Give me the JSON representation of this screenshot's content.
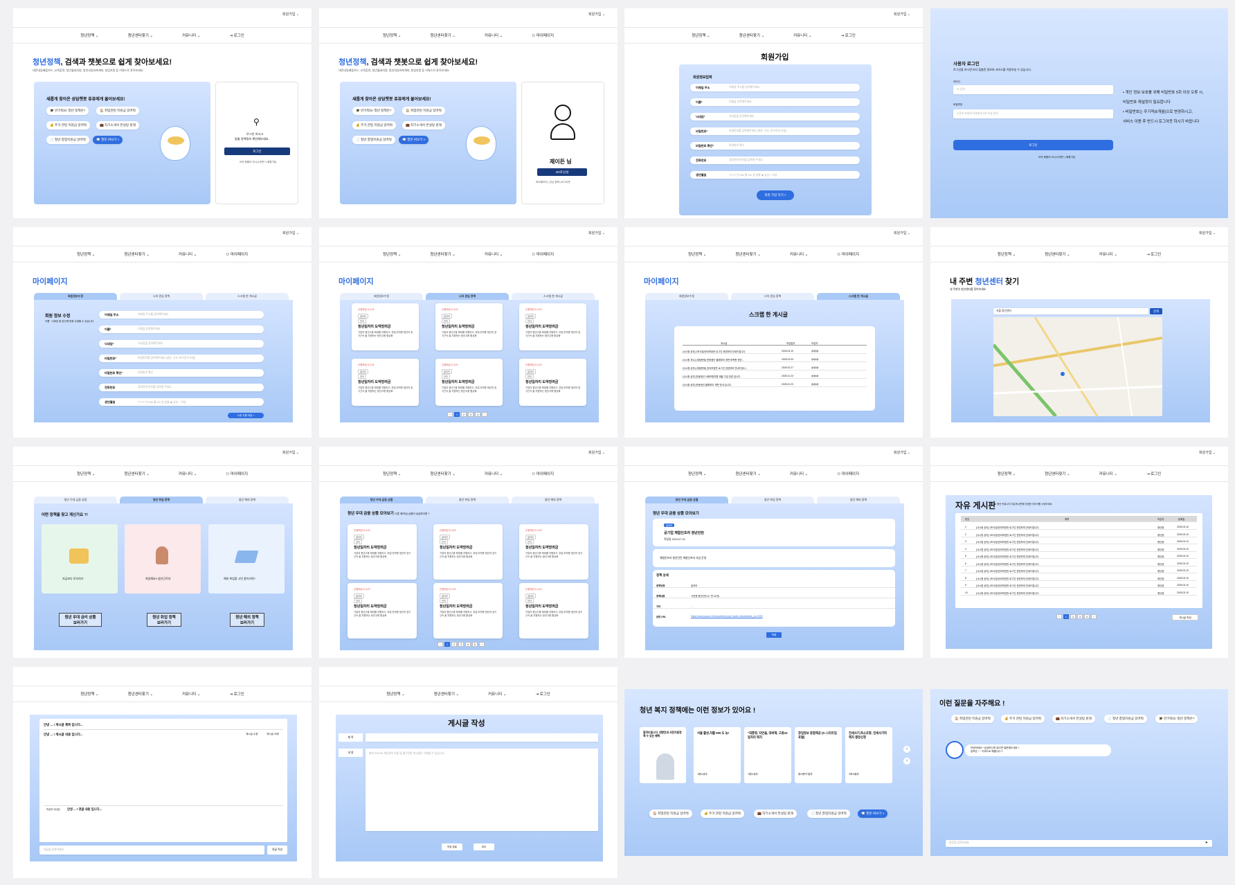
{
  "common": {
    "util": "회원가입 ⌄",
    "nav": [
      "청년정책 ⌄",
      "청년센터찾기 ⌄",
      "커뮤니티 ⌄"
    ],
    "login": "⇥ 로그인",
    "mypage": "⚇ 마이페이지"
  },
  "home": {
    "title_acc": "청년정책",
    "title_rest": ", 검색과 챗봇으로 쉽게 찾아보세요!",
    "sub": "대전내일배움카드, 교육훈련, 청년월세지원, 청년내일저축계좌, 창업지원 등 키워드로 찾아보세요.",
    "chat_title": "새롭게 찾아온 상담챗봇 퓨퓨에게 물어보세요!",
    "chips": [
      "🎓 반가워요! 청년 정책은?",
      "🏠 취업관련 지원금 알려줘",
      "💰 주거 관련 지원금 알려줘",
      "💼 자기소개서 컨설팅 원해",
      "📄 청년 창업지원금 알려줘",
      "💬 챗봇 써보기 >"
    ],
    "login_msg1": "로그인 하시고",
    "login_msg2": "맞춤 정책정보 확인해보세요.",
    "login_btn": "로그인",
    "login_links": "아직 회원이 아니시라면? | 회원가입",
    "user_name": "제이든 님",
    "user_btn": "25세 남성",
    "user_links": "마이페이지 | 관심 정책 | 로그아웃"
  },
  "signup": {
    "title": "회원가입",
    "section": "회원정보입력",
    "fields": [
      [
        "이메일 주소",
        "이메일 주소를 입력해주세요."
      ],
      [
        "이름*",
        "이름을 입력해주세요."
      ],
      [
        "닉네임*",
        "닉네임을 입력해주세요."
      ],
      [
        "비밀번호*",
        "비밀번호를 입력해주세요 (영문, 숫자, 특수문자 조합)"
      ],
      [
        "비밀번호 확인*",
        "비밀번호 확인"
      ],
      [
        "전화번호",
        "휴대전화 번호를 입력해 주세요"
      ],
      [
        "생년월일",
        "YYYY  년  MM  월  DD  일   성별  ◉ 남성  ○ 여성"
      ]
    ],
    "btn": "회원 가입 하기 >"
  },
  "login": {
    "title": "사용자 로그인",
    "sub": "로그인을 하시면 보다 맞춤된 정보와 서비스를 이용하실 수 있습니다.",
    "id_label": "아이디",
    "id_ph": "ID 입력",
    "pw_label": "비밀번호",
    "pw_ph": "소문자 포함된 비밀번호 8자 이상 입력",
    "btn": "로그인",
    "links": "아직 회원이 아니시라면? | 회원가입",
    "notes": [
      "• 개인 정보 보호를 위해 비밀번호 5회 이상 오류 시,",
      "  비밀번호 재설정이 필요합니다",
      "• 비밀번호는 주기적(6개월)으로 변경하시고,",
      "  서비스 이용 후 반드시 로그아웃 하시기 바랍니다"
    ]
  },
  "mypage": {
    "title": "마이페이지",
    "tabs": [
      "회원정보수정",
      "나의 관심 정책",
      "스크랩 한 게시글"
    ],
    "edit_title": "회원 정보 수정",
    "edit_sub": "이름 · 닉네임 등 당신에 맞춰 수정할 수 있습니다.",
    "edit_btn": "수정 사항 저장 >",
    "scrap_title": "스크랩 한 게시글",
    "scrap_head": [
      "게시글",
      "작성일자",
      "작성자"
    ],
    "scrap_rows": [
      [
        "[사시청 공지] 1조사업/권리보장반 로그인 관련하여 안내드립니다.",
        "2025.03.10",
        "@@@"
      ],
      [
        "[사시청 게시] (계정문제) 운동청년 올해부터 개편 토목총 관련 ...",
        "2025.03.03",
        "@@@"
      ],
      [
        "[사시청 공지] (계정문제) 권리보장반 로그인 관련하여 안내드립니...",
        "2025.02.27",
        "@@@"
      ],
      [
        "[사시청 공지] 운동청년 사회보험지원 제출 가입 관련 입니다",
        "2025.01.23",
        "@@@"
      ],
      [
        "[사시청 공지] 운동청년 올해부터 개편 안내 입니다",
        "2025.01.23",
        "@@@"
      ]
    ]
  },
  "card": {
    "tag": "신청마감 D-123",
    "t1": "일자리",
    "t2": "전국",
    "title": "청년일자리 도약장려금",
    "body": "기업의 청년고용 확대를 지원하고, 취업 취약층 청년의 장기근속 을 지원하는 청년고용 활성화"
  },
  "center": {
    "title_a": "내 주변 ",
    "title_acc": "청년센터",
    "title_b": " 찾기",
    "sub": "내 주변의 청년센터를 찾아보세요",
    "search": "서울 청년센터",
    "search_btn": "검색"
  },
  "policy": {
    "tabs": [
      "청년 우대 금융 상품",
      "청년 취업 정책",
      "청년 해외 정책"
    ],
    "question": "어떤 정책을 찾고 계신가요 ?!",
    "items": [
      "지금보다 투자하기",
      "취업해요!! 청년근로자",
      "해외 취업을 고민 중이라면?"
    ],
    "btns": [
      "청년 우대 금리 상품\n보러가기",
      "청년 취업 정책\n보러가기",
      "청년 해외 정책\n보러가기"
    ],
    "list_title": "청년 우대 금융 상품 모아보기",
    "list_sub": "다른 예/적금 상품이 궁금하다면 ?",
    "detail_badge": "일자리",
    "detail_title": "공기업 체험인프라 청년인턴",
    "detail_date": "작성일  2024.07.23",
    "detail_desc": "체험인프라 청년인턴 체험인프라 사업 운영",
    "detail_sec": "정책 상세",
    "detail_rows": [
      [
        "정책유형",
        "일자리"
      ],
      [
        "정책내용",
        "사전정 청년인턴 (1~연 24개)"
      ],
      [
        "기타",
        "-"
      ],
      [
        "관련 URL",
        "https://www.ycaa.or.kr/board/notice.jsp?mode=view&article_no=2025"
      ]
    ],
    "detail_btn": "목록"
  },
  "board": {
    "title": "자유 게시판",
    "sub": "청년 커뮤니티 자유게시판에 다양한 이야기를 나눠보세요",
    "head": [
      "번호",
      "제목",
      "작성자",
      "등록일"
    ],
    "row": "[사시청 공지] 1조사업/권리보장반 로그인 관련하여 안내드립니다.",
    "writer": "청년광",
    "date": "2025.03.10",
    "btn": "게시글 작성"
  },
  "post": {
    "title": "안녕 ... ! 게시글 제목 입니다...",
    "body": "안녕 ... ! 게시글 내용 입니다...",
    "edit": "게시글 수정",
    "del": "게시글 삭제",
    "c_author": "작성자 닉네임",
    "c_text": "안녕 ... ! 댓글 내용 입니다...",
    "c_ph": "댓글을 입력하세요.",
    "c_btn": "댓글 작성"
  },
  "write": {
    "title": "게시글 작성",
    "label_t": "제 목",
    "label_c": "내 용",
    "ph": "최대 3000자 개인정보 유출 및 불건전한 게시물은 삭제될 수 있습니다.",
    "save": "작성 완료",
    "cancel": "취소"
  },
  "welfare": {
    "title": "청년 복지 정책에는 이런 정보가 있어요 !",
    "intro": "알려드립니다. 대량안내 서민지원정책 수 있는 혜택",
    "cards": [
      "서울 활성,자활 500 도 농!",
      "\"대통령, 자연을, 대비해, 고용24 일자리 뭐지",
      "창업정보 종합제공 (K-스타트업 포털)",
      "전세사기,독소조항, 전세사기피해자 결정신청"
    ],
    "orgs": [
      "고용노동부",
      "고용노동부",
      "중소벤처기업부",
      "국토교통부"
    ],
    "chips": [
      "🏠 취업관련 지원금 알려줘",
      "💰 주거 관련 지원금 알려줘",
      "💼 자기소개서 컨설팅 원해",
      "📄 청년 창업지원금 알려줘",
      "💬 챗봇 써보기 >"
    ]
  },
  "faq": {
    "title": "이런 질문을 자주해요 !",
    "chips": [
      "🏠 취업관련 지원금 알려줘",
      "💰 주거 관련 지원금 알려줘",
      "💼 자기소개서 컨설팅 원해",
      "📄 청년 창업지원금 알려줘",
      "🎓 반가워요! 청년 정책은?"
    ],
    "bot": "안녕하세요 ! 궁금하신게 있다면 질문해주세요 !\n입력은 ~~ 키워드로 해줍니다 !!",
    "input_ph": "질문을 입력하세요"
  },
  "colors": {
    "accent": "#2f6ee0",
    "panel_blue": "#a9c9f7"
  }
}
